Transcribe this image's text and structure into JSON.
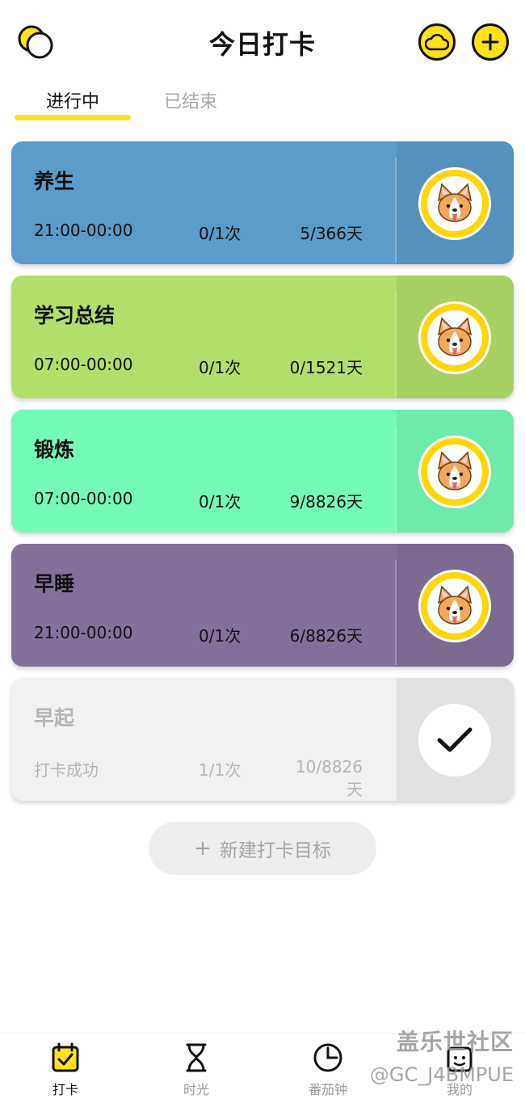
{
  "header": {
    "title": "今日打卡",
    "left_icon": "moon-icon",
    "right_icons": [
      "cloud-icon",
      "plus-icon"
    ],
    "accent": "#FFE11A"
  },
  "tabs": [
    {
      "label": "进行中",
      "active": true
    },
    {
      "label": "已结束",
      "active": false
    }
  ],
  "cards": [
    {
      "title": "养生",
      "time": "21:00-00:00",
      "count": "0/1次",
      "days": "5/366天",
      "color": "#5B9BC9",
      "status": "pending"
    },
    {
      "title": "学习总结",
      "time": "07:00-00:00",
      "count": "0/1次",
      "days": "0/1521天",
      "color": "#B4DE6C",
      "status": "pending"
    },
    {
      "title": "锻炼",
      "time": "07:00-00:00",
      "count": "0/1次",
      "days": "9/8826天",
      "color": "#74FAB8",
      "status": "pending"
    },
    {
      "title": "早睡",
      "time": "21:00-00:00",
      "count": "0/1次",
      "days": "6/8826天",
      "color": "#84719A",
      "status": "pending"
    },
    {
      "title": "早起",
      "time": "打卡成功",
      "count": "1/1次",
      "days": "10/8826天",
      "color": "#F1F1F1",
      "status": "done"
    }
  ],
  "new_goal": {
    "label": "新建打卡目标",
    "icon": "plus-icon"
  },
  "bottom_nav": [
    {
      "label": "打卡",
      "icon": "calendar-check-icon",
      "active": true
    },
    {
      "label": "时光",
      "icon": "hourglass-icon",
      "active": false
    },
    {
      "label": "番茄钟",
      "icon": "clock-icon",
      "active": false
    },
    {
      "label": "我的",
      "icon": "profile-icon",
      "active": false
    }
  ],
  "watermark": {
    "line1": "盖乐世社区",
    "line2": "@GC_J4BMPUE"
  }
}
